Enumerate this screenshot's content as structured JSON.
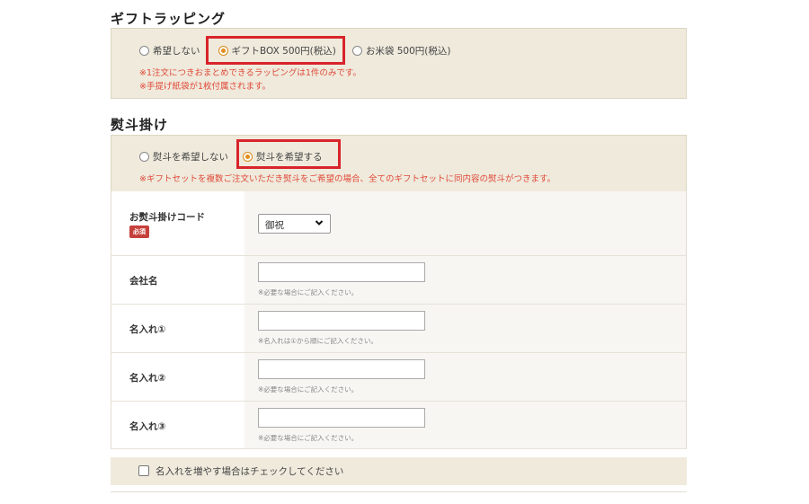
{
  "gift_wrapping": {
    "title": "ギフトラッピング",
    "options": [
      {
        "label": "希望しない",
        "checked": false
      },
      {
        "label": "ギフトBOX 500円(税込)",
        "checked": true
      },
      {
        "label": "お米袋 500円(税込)",
        "checked": false
      }
    ],
    "notes": [
      "※1注文につきおまとめできるラッピングは1件のみです。",
      "※手提げ紙袋が1枚付属されます。"
    ]
  },
  "noshi": {
    "title": "熨斗掛け",
    "options": [
      {
        "label": "熨斗を希望しない",
        "checked": false
      },
      {
        "label": "熨斗を希望する",
        "checked": true
      }
    ],
    "note": "※ギフトセットを複数ご注文いただき熨斗をご希望の場合、全てのギフトセットに同内容の熨斗がつきます。"
  },
  "form": {
    "noshi_code": {
      "label": "お熨斗掛けコード",
      "required": "必須",
      "selected": "御祝"
    },
    "company": {
      "label": "会社名",
      "value": "",
      "hint": "※必要な場合にご記入ください。"
    },
    "name1": {
      "label": "名入れ①",
      "value": "",
      "hint": "※名入れは①から順にご記入ください。"
    },
    "name2": {
      "label": "名入れ②",
      "value": "",
      "hint": "※必要な場合にご記入ください。"
    },
    "name3": {
      "label": "名入れ③",
      "value": "",
      "hint": "※必要な場合にご記入ください。"
    }
  },
  "add_names_checkbox": {
    "label": "名入れを増やす場合はチェックしてください",
    "checked": false
  },
  "colors": {
    "accent": "#e08d1a",
    "highlight": "#d8242b",
    "note_red": "#e04a3a",
    "beige": "#efeadc",
    "badge": "#c6413b"
  }
}
